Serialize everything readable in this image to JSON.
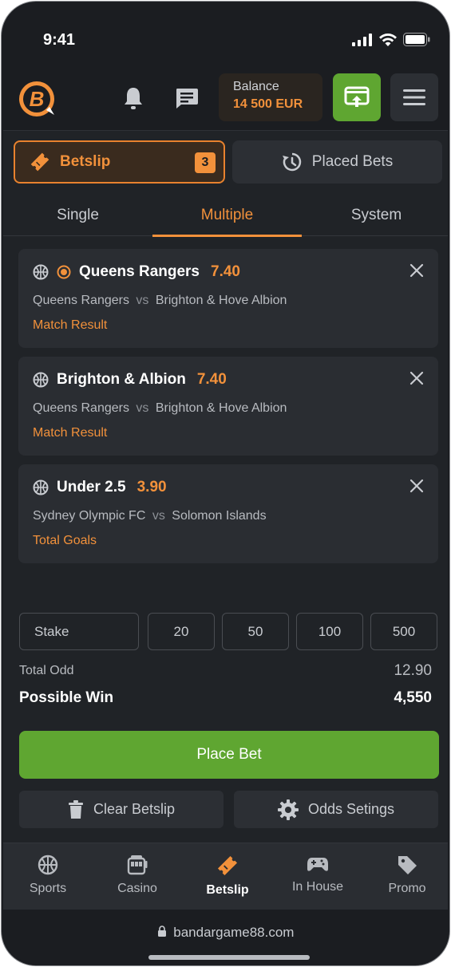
{
  "status_bar": {
    "time": "9:41"
  },
  "header": {
    "balance_label": "Balance",
    "balance_value": "14 500 EUR"
  },
  "top_tabs": {
    "betslip": {
      "label": "Betslip",
      "count": "3"
    },
    "placed": {
      "label": "Placed Bets"
    }
  },
  "bet_types": [
    {
      "label": "Single"
    },
    {
      "label": "Multiple",
      "active": true
    },
    {
      "label": "System"
    }
  ],
  "bets": [
    {
      "selection": "Queens Rangers",
      "odd": "7.40",
      "home": "Queens Rangers",
      "vs": "vs",
      "away": "Brighton & Hove Albion",
      "market": "Match Result"
    },
    {
      "selection": "Brighton & Albion",
      "odd": "7.40",
      "home": "Queens Rangers",
      "vs": "vs",
      "away": "Brighton & Hove Albion",
      "market": "Match Result"
    },
    {
      "selection": "Under 2.5",
      "odd": "3.90",
      "home": "Sydney Olympic FC",
      "vs": "vs",
      "away": "Solomon Islands",
      "market": "Total Goals"
    }
  ],
  "stake": {
    "placeholder": "Stake",
    "quick_amounts": [
      "20",
      "50",
      "100",
      "500"
    ]
  },
  "summary": {
    "total_odd_label": "Total Odd",
    "total_odd_value": "12.90",
    "possible_win_label": "Possible Win",
    "possible_win_value": "4,550"
  },
  "actions": {
    "place_bet": "Place Bet",
    "clear_betslip": "Clear Betslip",
    "odds_settings": "Odds Setings"
  },
  "bottom_nav": [
    {
      "label": "Sports",
      "icon": "basketball-icon"
    },
    {
      "label": "Casino",
      "icon": "slot-machine-icon"
    },
    {
      "label": "Betslip",
      "icon": "ticket-icon",
      "active": true
    },
    {
      "label": "In House",
      "icon": "gamepad-icon"
    },
    {
      "label": "Promo",
      "icon": "tag-icon"
    }
  ],
  "browser": {
    "url": "bandargame88.com"
  },
  "colors": {
    "accent": "#f2913b",
    "green": "#5fa631",
    "background": "#202327",
    "card": "#2a2d32"
  }
}
